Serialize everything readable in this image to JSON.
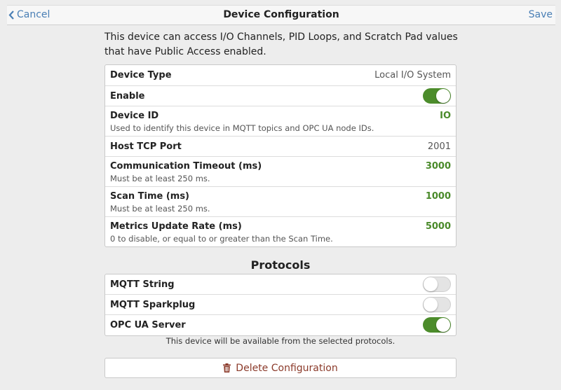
{
  "nav": {
    "cancel_label": "Cancel",
    "title": "Device Configuration",
    "save_label": "Save"
  },
  "intro_text": "This device can access I/O Channels, PID Loops, and Scratch Pad values that have Public Access enabled.",
  "settings": {
    "device_type": {
      "label": "Device Type",
      "value": "Local I/O System"
    },
    "enable": {
      "label": "Enable",
      "on": true
    },
    "device_id": {
      "label": "Device ID",
      "desc": "Used to identify this device in MQTT topics and OPC UA node IDs.",
      "value": "IO"
    },
    "host_tcp_port": {
      "label": "Host TCP Port",
      "value": "2001"
    },
    "comm_timeout": {
      "label": "Communication Timeout (ms)",
      "desc": "Must be at least 250 ms.",
      "value": "3000"
    },
    "scan_time": {
      "label": "Scan Time (ms)",
      "desc": "Must be at least 250 ms.",
      "value": "1000"
    },
    "metrics_rate": {
      "label": "Metrics Update Rate (ms)",
      "desc": "0 to disable, or equal to or greater than the Scan Time.",
      "value": "5000"
    }
  },
  "protocols": {
    "title": "Protocols",
    "mqtt_string": {
      "label": "MQTT String",
      "on": false
    },
    "mqtt_sparkplug": {
      "label": "MQTT Sparkplug",
      "on": false
    },
    "opc_ua": {
      "label": "OPC UA Server",
      "on": true
    },
    "note": "This device will be available from the selected protocols."
  },
  "delete_label": "Delete Configuration",
  "colors": {
    "accent_blue": "#4a7fb5",
    "value_green": "#4a8a2a",
    "toggle_on": "#4c8c2b",
    "delete_red": "#8b3a2a"
  },
  "icons": {
    "cancel": "chevron-left-icon",
    "delete": "trash-icon"
  }
}
